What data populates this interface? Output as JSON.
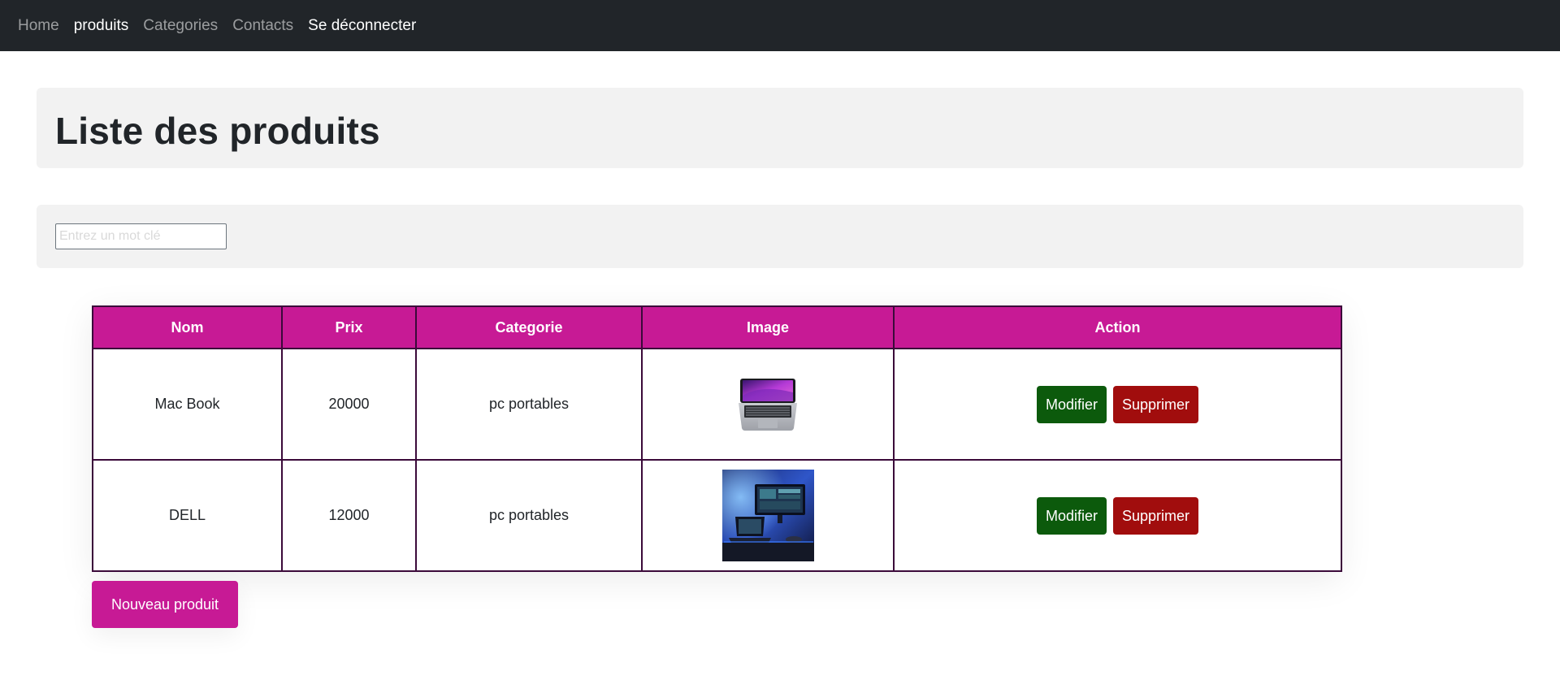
{
  "navbar": {
    "items": [
      {
        "label": "Home"
      },
      {
        "label": "produits"
      },
      {
        "label": "Categories"
      },
      {
        "label": "Contacts"
      },
      {
        "label": "Se déconnecter"
      }
    ]
  },
  "page": {
    "title": "Liste des produits"
  },
  "search": {
    "placeholder": "Entrez un mot clé",
    "value": ""
  },
  "table": {
    "headers": [
      "Nom",
      "Prix",
      "Categorie",
      "Image",
      "Action"
    ],
    "rows": [
      {
        "nom": "Mac Book",
        "prix": "20000",
        "categorie": "pc portables",
        "image": "macbook-image",
        "modifier": "Modifier",
        "supprimer": "Supprimer"
      },
      {
        "nom": "DELL",
        "prix": "12000",
        "categorie": "pc portables",
        "image": "dell-setup-image",
        "modifier": "Modifier",
        "supprimer": "Supprimer"
      }
    ]
  },
  "actions": {
    "new_product": "Nouveau produit"
  },
  "colors": {
    "navbar": "#212529",
    "accent": "#c71a95",
    "modifier": "#0c5a0c",
    "supprimer": "#a10d0d",
    "panel": "#f2f2f2"
  }
}
